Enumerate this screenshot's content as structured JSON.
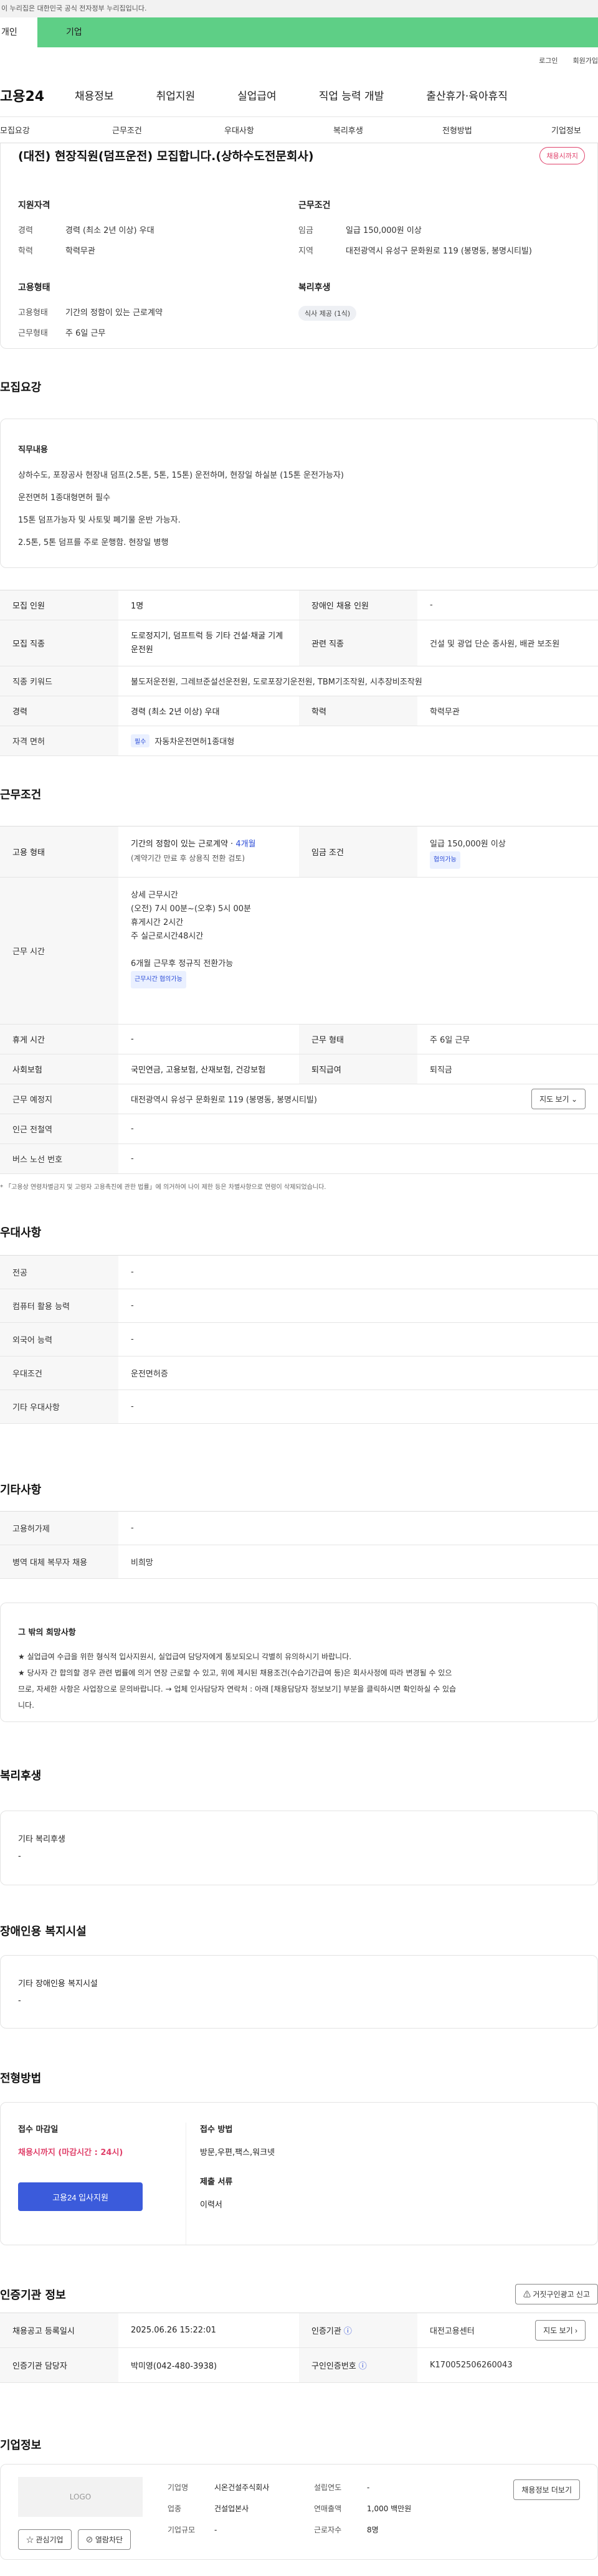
{
  "gov_banner": "이 누리집은 대한민국 공식 전자정부 누리집입니다.",
  "top_tabs": {
    "person": "개인",
    "company": "기업"
  },
  "util": {
    "login": "로그인",
    "join": "회원가입"
  },
  "logo": "고용24",
  "gnb": [
    "채용정보",
    "취업지원",
    "실업급여",
    "직업 능력 개발",
    "출산휴가·육아휴직"
  ],
  "subnav": [
    "모집요강",
    "근무조건",
    "우대사항",
    "복리후생",
    "전형방법",
    "기업정보"
  ],
  "job": {
    "title": "(대전) 현장직원(덤프운전) 모집합니다.(상하수도전문회사)",
    "status": "채용시까지",
    "qual_label": "지원자격",
    "qual": [
      {
        "k": "경력",
        "v": "경력 (최소 2년 이상) 우대"
      },
      {
        "k": "학력",
        "v": "학력무관"
      }
    ],
    "cond_label": "근무조건",
    "cond": [
      {
        "k": "임금",
        "v": "일급 150,000원 이상"
      },
      {
        "k": "지역",
        "v": "대전광역시 유성구 문화원로 119 (봉명동, 봉명시티빌)"
      }
    ],
    "emp_label": "고용형태",
    "emp": [
      {
        "k": "고용형태",
        "v": "기간의 정함이 있는 근로계약"
      },
      {
        "k": "근무형태",
        "v": "주 6일 근무"
      }
    ],
    "welfare_label": "복리후생",
    "welfare_chip": "식사 제공 (1식)"
  },
  "recruit": {
    "title": "모집요강",
    "duty_label": "직무내용",
    "duty_lines": [
      "상하수도, 포장공사 현장내 덤프(2.5톤, 5톤, 15톤) 운전하며, 현장일 하실분 (15톤 운전가능자)",
      "운전면허 1종대형면허 필수",
      "15톤 덤프가능자 및 사토및 폐기물 운반 가능자.",
      "2.5톤, 5톤 덤프를 주로 운행함. 현장일 병행"
    ],
    "rows": {
      "headcount_k": "모집 인원",
      "headcount_v": "1명",
      "disabled_k": "장애인 채용 인원",
      "disabled_v": "-",
      "job_k": "모집 직종",
      "job_v": "도로정지기, 덤프트럭 등 기타 건설·채굴 기계 운전원",
      "related_k": "관련 직종",
      "related_v": "건설 및 광업 단순 종사원, 배관 보조원",
      "kw_k": "직종 키워드",
      "kw_v": "불도저운전원, 그레브준설선운전원, 도로포장기운전원, TBM기조작원, 시추장비조작원",
      "career_k": "경력",
      "career_v": "경력 (최소 2년 이상) 우대",
      "edu_k": "학력",
      "edu_v": "학력무관",
      "license_k": "자격 면허",
      "license_tag": "필수",
      "license_v": "자동차운전면허1종대형"
    }
  },
  "work": {
    "title": "근무조건",
    "emp_k": "고용 형태",
    "emp_v1": "기간의 정함이 있는 근로계약 · ",
    "emp_v1b": "4개월",
    "emp_v2": "(계약기간 만료 후 상용직 전환 검토)",
    "wage_k": "임금 조건",
    "wage_v": "일급 150,000원 이상",
    "wage_tag": "협의가능",
    "hours_k": "근무 시간",
    "hours_lines": [
      "상세 근무시간",
      "(오전) 7시 00분~(오후) 5시 00분",
      "휴게시간 2시간",
      "주 실근로시간48시간",
      "",
      "6개월 근무후 정규직 전환가능"
    ],
    "hours_tag": "근무시간 협의가능",
    "break_k": "휴게 시간",
    "break_v": "-",
    "shift_k": "근무 형태",
    "shift_v": "주 6일 근무",
    "ins_k": "사회보험",
    "ins_v": "국민연금, 고용보험, 산재보험, 건강보험",
    "sev_k": "퇴직급여",
    "sev_v": "퇴직금",
    "place_k": "근무 예정지",
    "place_v": "대전광역시 유성구 문화원로 119 (봉명동, 봉명시티빌)",
    "map_btn": "지도 보기",
    "subway_k": "인근 전철역",
    "subway_v": "-",
    "bus_k": "버스 노선 번호",
    "bus_v": "-",
    "note": "* 「고용상 연령차별금지 및 고령자 고용촉진에 관한 법률」에 의거하여 나이 제한 등은 차별사항으로 연령이 삭제되었습니다."
  },
  "pref": {
    "title": "우대사항",
    "rows": [
      {
        "k": "전공",
        "v": "-"
      },
      {
        "k": "컴퓨터 활용 능력",
        "v": "-"
      },
      {
        "k": "외국어 능력",
        "v": "-"
      },
      {
        "k": "우대조건",
        "v": "운전면허증"
      },
      {
        "k": "기타 우대사항",
        "v": "-"
      }
    ]
  },
  "etc": {
    "title": "기타사항",
    "rows": [
      {
        "k": "고용허가제",
        "v": "-"
      },
      {
        "k": "병역 대체 복무자 채용",
        "v": "비희망"
      }
    ],
    "wish_title": "그 밖의 희망사항",
    "wish_lines": [
      "★ 실업급여 수급을 위한 형식적 입사지원시, 실업급여 담당자에게 통보되오니 각별히 유의하시기 바랍니다.",
      "★ 당사자 간 합의할 경우 관련 법률에 의거 연장 근로할 수 있고, 위에 제시된 채용조건(수습기간급여 등)은 회사사정에 따라 변경될 수 있으",
      "므로, 자세한 사항은 사업장으로 문의바랍니다. → 업체 인사담당자 연락처 : 아래 [채용담당자 정보보기] 부분을 클릭하시면 확인하실 수 있습",
      "니다."
    ]
  },
  "welfare": {
    "title": "복리후생",
    "label": "기타 복리후생",
    "value": "-"
  },
  "disab": {
    "title": "장애인용 복지시설",
    "label": "기타 장애인용 복지시설",
    "value": "-"
  },
  "process": {
    "title": "전형방법",
    "deadline_label": "접수 마감일",
    "deadline_value": "채용시까지 (마감시간 : 24시)",
    "apply_btn": "고용24 입사지원",
    "method_label": "접수 방법",
    "method_value": "방문,우편,팩스,워크넷",
    "docs_label": "제출 서류",
    "docs_value": "이력서"
  },
  "agency": {
    "title": "인증기관 정보",
    "report_btn": "거짓구인광고 신고",
    "reg_k": "채용공고 등록일시",
    "reg_v": "2025.06.26 15:22:01",
    "org_k": "인증기관",
    "org_v": "대전고용센터",
    "map_btn": "지도 보기",
    "mgr_k": "인증기관 담당자",
    "mgr_v": "박미영(042-480-3938)",
    "num_k": "구인인증번호",
    "num_v": "K170052506260043"
  },
  "company": {
    "title": "기업정보",
    "logo": "LOGO",
    "interest_btn": "관심기업",
    "block_btn": "열람차단",
    "name_k": "기업명",
    "name_v": "시온건설주식회사",
    "est_k": "설립연도",
    "est_v": "-",
    "ind_k": "업종",
    "ind_v": "건설업본사",
    "rev_k": "연매출액",
    "rev_v": "1,000 백만원",
    "size_k": "기업규모",
    "size_v": "-",
    "emp_k": "근로자수",
    "emp_v": "8명",
    "jobs_btn": "채용정보 더보기"
  }
}
